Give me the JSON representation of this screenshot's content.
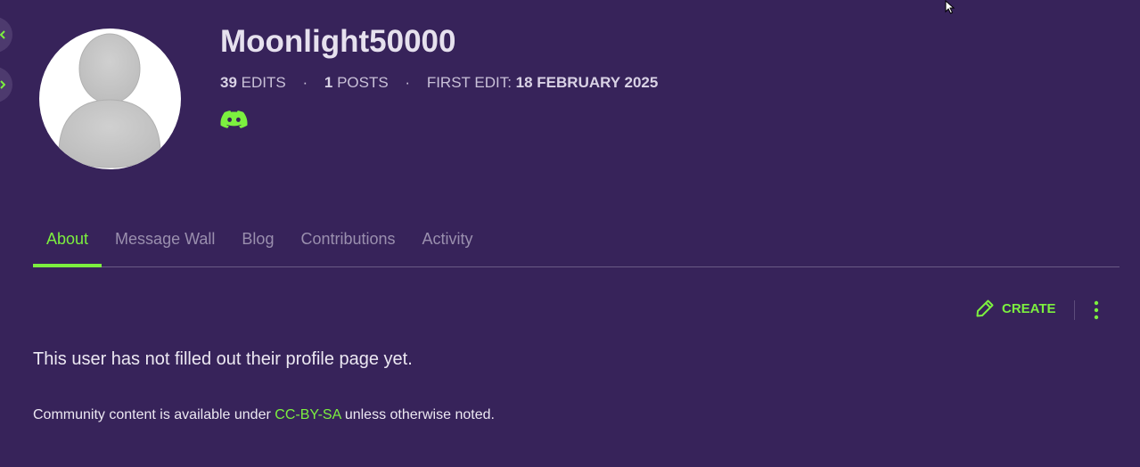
{
  "profile": {
    "username": "Moonlight50000",
    "edits_count": "39",
    "edits_label": "EDITS",
    "posts_count": "1",
    "posts_label": "POSTS",
    "first_edit_label": "FIRST EDIT:",
    "first_edit_date": "18 FEBRUARY 2025",
    "separator": "·",
    "avatar_icon": "default-user-avatar",
    "social_icon": "discord-icon"
  },
  "tabs": [
    {
      "label": "About",
      "active": true
    },
    {
      "label": "Message Wall",
      "active": false
    },
    {
      "label": "Blog",
      "active": false
    },
    {
      "label": "Contributions",
      "active": false
    },
    {
      "label": "Activity",
      "active": false
    }
  ],
  "toolbar": {
    "create_label": "CREATE",
    "create_icon": "pencil-icon",
    "more_icon": "kebab-menu-icon"
  },
  "content": {
    "empty_message": "This user has not filled out their profile page yet."
  },
  "footer": {
    "license_prefix": "Community content is available under",
    "license_link": "CC-BY-SA",
    "license_suffix": "unless otherwise noted."
  },
  "colors": {
    "background": "#37235a",
    "accent": "#7cf03f",
    "muted_text": "#9a8fae"
  }
}
